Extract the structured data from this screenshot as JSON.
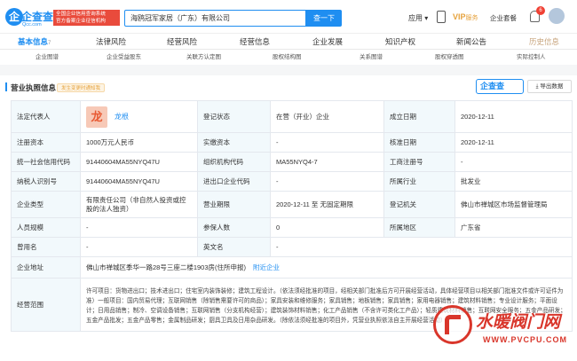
{
  "header": {
    "logo_text": "企查查",
    "logo_sub": "Qcc.com",
    "logo_mark": "企",
    "tag_line1": "全国企业信用查询系统",
    "tag_line2": "官方备案企业征信机构",
    "search_value": "海鸥冠军家居（广东）有限公司",
    "search_button": "查一下",
    "nav_app": "应用",
    "nav_vip": "VIP",
    "nav_vip_suffix": "服务",
    "nav_enterprise": "企业套餐",
    "notification_count": "6"
  },
  "tabs": [
    {
      "label": "基本信息",
      "count": "7",
      "active": true
    },
    {
      "label": "法律风险"
    },
    {
      "label": "经营风险"
    },
    {
      "label": "经营信息"
    },
    {
      "label": "企业发展"
    },
    {
      "label": "知识产权"
    },
    {
      "label": "新闻公告"
    },
    {
      "label": "历史信息"
    }
  ],
  "subtabs": [
    "企业图谱",
    "企业受益股东",
    "关联方认定图",
    "股权结构图",
    "关系图谱",
    "股权穿透图",
    "实际控制人"
  ],
  "section": {
    "title": "营业执照信息",
    "badge": "发生变更时通知我",
    "brand_logo": "企查查",
    "export_button": "导出数据"
  },
  "table": {
    "legal_rep_label": "法定代表人",
    "legal_rep_avatar": "龙",
    "legal_rep_name": "龙根",
    "status_label": "登记状态",
    "status_value": "在营（开业）企业",
    "founded_label": "成立日期",
    "founded_value": "2020-12-11",
    "reg_capital_label": "注册资本",
    "reg_capital_value": "1000万元人民币",
    "paid_capital_label": "实缴资本",
    "paid_capital_value": "-",
    "approval_label": "核准日期",
    "approval_value": "2020-12-11",
    "credit_code_label": "统一社会信用代码",
    "credit_code_value": "91440604MA55NYQ47U",
    "org_code_label": "组织机构代码",
    "org_code_value": "MA55NYQ4-7",
    "biz_reg_label": "工商注册号",
    "biz_reg_value": "-",
    "taxpayer_label": "纳税人识别号",
    "taxpayer_value": "91440604MA55NYQ47U",
    "import_export_label": "进出口企业代码",
    "import_export_value": "-",
    "industry_label": "所属行业",
    "industry_value": "批发业",
    "type_label": "企业类型",
    "type_value": "有限责任公司（非自然人投资或控股的法人独资）",
    "term_label": "营业期限",
    "term_value": "2020-12-11 至 无固定期限",
    "authority_label": "登记机关",
    "authority_value": "佛山市禅城区市场监督管理局",
    "staff_label": "人员规模",
    "staff_value": "-",
    "insured_label": "参保人数",
    "insured_value": "0",
    "region_label": "所属地区",
    "region_value": "广东省",
    "former_label": "曾用名",
    "former_value": "-",
    "english_label": "英文名",
    "english_value": "-",
    "address_label": "企业地址",
    "address_value": "佛山市禅城区季华一路28号三座二楼1903房(住所申报)",
    "address_link": "附近企业",
    "scope_label": "经营范围",
    "scope_value": "许可项目：货物进出口；技术进出口；住宅室内装饰装修；建筑工程设计。（依法须经批准的项目，经相关部门批准后方可开展经营活动，具体经营项目以相关部门批准文件或许可证件为准）一般项目：国内贸易代理；互联网销售（除销售需要许可的商品）；家具安装和维修服务；家具销售；地板销售；家具销售；家用电器销售；建筑材料销售；专业设计服务；平面设计；日用品销售；制冷、空调设备销售；互联网销售（分支机构经营）；建筑装饰材料销售；化工产品销售（不含许可类化工产品）；轻质建筑材料销售；互联网安全服务；五金产品研发；五金产品批发；五金产品零售；金属制品研发；厨具卫具及日用杂品研发。（除依法须经批准的项目外，凭营业执照依法自主开展经营活动）"
  },
  "watermark": {
    "title": "水暖阀门网",
    "url": "WWW.PVCPU.COM"
  }
}
